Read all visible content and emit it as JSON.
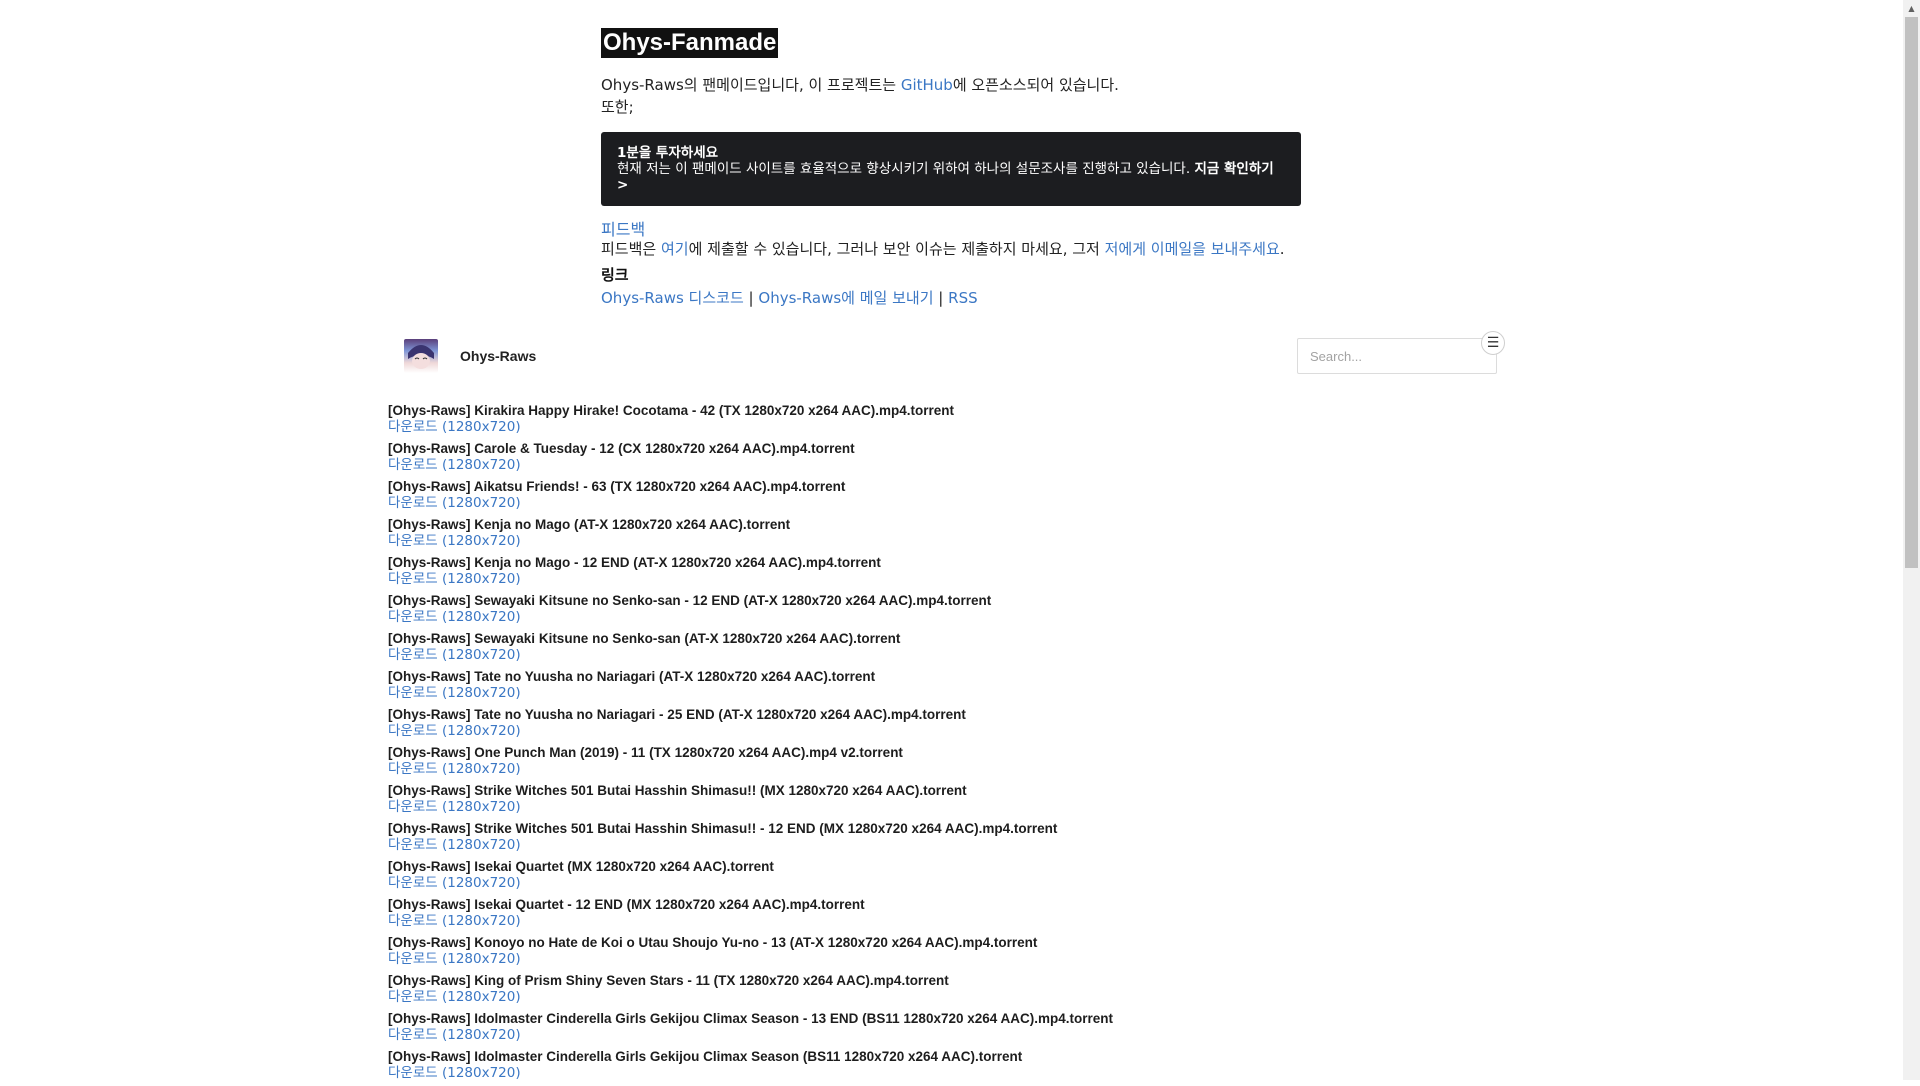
{
  "site_title": "Ohys-Fanmade",
  "intro": {
    "line1_prefix": "Ohys-Raws의 팬메이드입니다, 이 프로젝트는 ",
    "github_link": "GitHub",
    "line1_suffix": "에 오픈소스되어 있습니다.",
    "line2": "또한;"
  },
  "survey": {
    "title": "1분을 투자하세요",
    "text": "현재 저는 이 팬메이드 사이트를 효율적으로 향상시키기 위하여 하나의 설문조사를 진행하고 있습니다.",
    "cta": "지금 확인하기 >"
  },
  "feedback": {
    "title": "피드백",
    "prefix": "피드백은 ",
    "here_link": "여기",
    "middle": "에 제출할 수 있습니다, 그러나 보안 이슈는 제출하지 마세요, 그저 ",
    "email_link": "저에게 이메일을 보내주세요",
    "suffix": "."
  },
  "links": {
    "title": "링크",
    "discord": "Ohys-Raws 디스코드",
    "mail": "Ohys-Raws에 메일 보내기",
    "rss": "RSS",
    "separator": "|"
  },
  "profile": {
    "name": "Ohys-Raws"
  },
  "search": {
    "placeholder": "Search..."
  },
  "menu_icon": "hamburger-menu-icon",
  "torrents": [
    {
      "title": "[Ohys-Raws] Kirakira Happy Hirake! Cocotama - 42 (TX 1280x720 x264 AAC).mp4.torrent",
      "download": "다운로드 (1280x720)"
    },
    {
      "title": "[Ohys-Raws] Carole & Tuesday - 12 (CX 1280x720 x264 AAC).mp4.torrent",
      "download": "다운로드 (1280x720)"
    },
    {
      "title": "[Ohys-Raws] Aikatsu Friends! - 63 (TX 1280x720 x264 AAC).mp4.torrent",
      "download": "다운로드 (1280x720)"
    },
    {
      "title": "[Ohys-Raws] Kenja no Mago (AT-X 1280x720 x264 AAC).torrent",
      "download": "다운로드 (1280x720)"
    },
    {
      "title": "[Ohys-Raws] Kenja no Mago - 12 END (AT-X 1280x720 x264 AAC).mp4.torrent",
      "download": "다운로드 (1280x720)"
    },
    {
      "title": "[Ohys-Raws] Sewayaki Kitsune no Senko-san - 12 END (AT-X 1280x720 x264 AAC).mp4.torrent",
      "download": "다운로드 (1280x720)"
    },
    {
      "title": "[Ohys-Raws] Sewayaki Kitsune no Senko-san (AT-X 1280x720 x264 AAC).torrent",
      "download": "다운로드 (1280x720)"
    },
    {
      "title": "[Ohys-Raws] Tate no Yuusha no Nariagari (AT-X 1280x720 x264 AAC).torrent",
      "download": "다운로드 (1280x720)"
    },
    {
      "title": "[Ohys-Raws] Tate no Yuusha no Nariagari - 25 END (AT-X 1280x720 x264 AAC).mp4.torrent",
      "download": "다운로드 (1280x720)"
    },
    {
      "title": "[Ohys-Raws] One Punch Man (2019) - 11 (TX 1280x720 x264 AAC).mp4 v2.torrent",
      "download": "다운로드 (1280x720)"
    },
    {
      "title": "[Ohys-Raws] Strike Witches 501 Butai Hasshin Shimasu!! (MX 1280x720 x264 AAC).torrent",
      "download": "다운로드 (1280x720)"
    },
    {
      "title": "[Ohys-Raws] Strike Witches 501 Butai Hasshin Shimasu!! - 12 END (MX 1280x720 x264 AAC).mp4.torrent",
      "download": "다운로드 (1280x720)"
    },
    {
      "title": "[Ohys-Raws] Isekai Quartet (MX 1280x720 x264 AAC).torrent",
      "download": "다운로드 (1280x720)"
    },
    {
      "title": "[Ohys-Raws] Isekai Quartet - 12 END (MX 1280x720 x264 AAC).mp4.torrent",
      "download": "다운로드 (1280x720)"
    },
    {
      "title": "[Ohys-Raws] Konoyo no Hate de Koi o Utau Shoujo Yu-no - 13 (AT-X 1280x720 x264 AAC).mp4.torrent",
      "download": "다운로드 (1280x720)"
    },
    {
      "title": "[Ohys-Raws] King of Prism Shiny Seven Stars - 11 (TX 1280x720 x264 AAC).mp4.torrent",
      "download": "다운로드 (1280x720)"
    },
    {
      "title": "[Ohys-Raws] Idolmaster Cinderella Girls Gekijou Climax Season - 13 END (BS11 1280x720 x264 AAC).mp4.torrent",
      "download": "다운로드 (1280x720)"
    },
    {
      "title": "[Ohys-Raws] Idolmaster Cinderella Girls Gekijou Climax Season (BS11 1280x720 x264 AAC).torrent",
      "download": "다운로드 (1280x720)"
    }
  ]
}
